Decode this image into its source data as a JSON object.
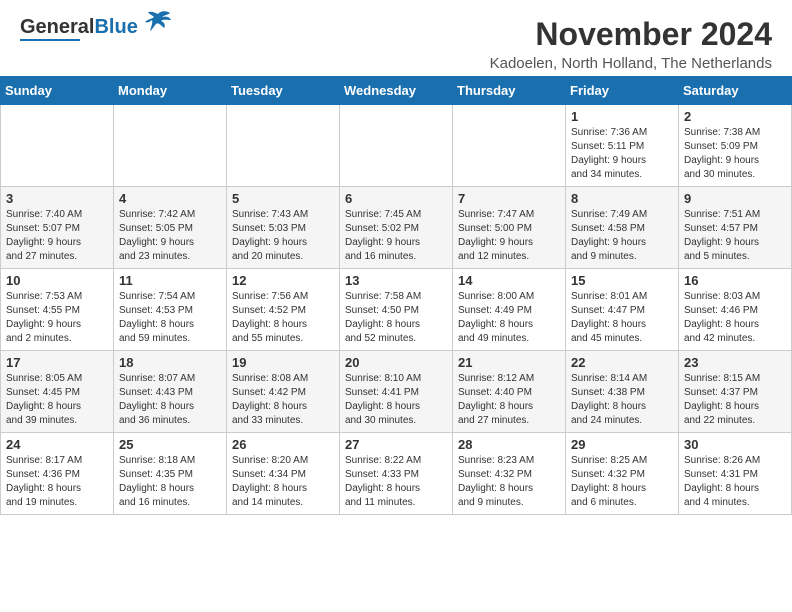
{
  "header": {
    "logo_general": "General",
    "logo_blue": "Blue",
    "month_title": "November 2024",
    "location": "Kadoelen, North Holland, The Netherlands"
  },
  "weekdays": [
    "Sunday",
    "Monday",
    "Tuesday",
    "Wednesday",
    "Thursday",
    "Friday",
    "Saturday"
  ],
  "weeks": [
    [
      {
        "day": "",
        "info": ""
      },
      {
        "day": "",
        "info": ""
      },
      {
        "day": "",
        "info": ""
      },
      {
        "day": "",
        "info": ""
      },
      {
        "day": "",
        "info": ""
      },
      {
        "day": "1",
        "info": "Sunrise: 7:36 AM\nSunset: 5:11 PM\nDaylight: 9 hours\nand 34 minutes."
      },
      {
        "day": "2",
        "info": "Sunrise: 7:38 AM\nSunset: 5:09 PM\nDaylight: 9 hours\nand 30 minutes."
      }
    ],
    [
      {
        "day": "3",
        "info": "Sunrise: 7:40 AM\nSunset: 5:07 PM\nDaylight: 9 hours\nand 27 minutes."
      },
      {
        "day": "4",
        "info": "Sunrise: 7:42 AM\nSunset: 5:05 PM\nDaylight: 9 hours\nand 23 minutes."
      },
      {
        "day": "5",
        "info": "Sunrise: 7:43 AM\nSunset: 5:03 PM\nDaylight: 9 hours\nand 20 minutes."
      },
      {
        "day": "6",
        "info": "Sunrise: 7:45 AM\nSunset: 5:02 PM\nDaylight: 9 hours\nand 16 minutes."
      },
      {
        "day": "7",
        "info": "Sunrise: 7:47 AM\nSunset: 5:00 PM\nDaylight: 9 hours\nand 12 minutes."
      },
      {
        "day": "8",
        "info": "Sunrise: 7:49 AM\nSunset: 4:58 PM\nDaylight: 9 hours\nand 9 minutes."
      },
      {
        "day": "9",
        "info": "Sunrise: 7:51 AM\nSunset: 4:57 PM\nDaylight: 9 hours\nand 5 minutes."
      }
    ],
    [
      {
        "day": "10",
        "info": "Sunrise: 7:53 AM\nSunset: 4:55 PM\nDaylight: 9 hours\nand 2 minutes."
      },
      {
        "day": "11",
        "info": "Sunrise: 7:54 AM\nSunset: 4:53 PM\nDaylight: 8 hours\nand 59 minutes."
      },
      {
        "day": "12",
        "info": "Sunrise: 7:56 AM\nSunset: 4:52 PM\nDaylight: 8 hours\nand 55 minutes."
      },
      {
        "day": "13",
        "info": "Sunrise: 7:58 AM\nSunset: 4:50 PM\nDaylight: 8 hours\nand 52 minutes."
      },
      {
        "day": "14",
        "info": "Sunrise: 8:00 AM\nSunset: 4:49 PM\nDaylight: 8 hours\nand 49 minutes."
      },
      {
        "day": "15",
        "info": "Sunrise: 8:01 AM\nSunset: 4:47 PM\nDaylight: 8 hours\nand 45 minutes."
      },
      {
        "day": "16",
        "info": "Sunrise: 8:03 AM\nSunset: 4:46 PM\nDaylight: 8 hours\nand 42 minutes."
      }
    ],
    [
      {
        "day": "17",
        "info": "Sunrise: 8:05 AM\nSunset: 4:45 PM\nDaylight: 8 hours\nand 39 minutes."
      },
      {
        "day": "18",
        "info": "Sunrise: 8:07 AM\nSunset: 4:43 PM\nDaylight: 8 hours\nand 36 minutes."
      },
      {
        "day": "19",
        "info": "Sunrise: 8:08 AM\nSunset: 4:42 PM\nDaylight: 8 hours\nand 33 minutes."
      },
      {
        "day": "20",
        "info": "Sunrise: 8:10 AM\nSunset: 4:41 PM\nDaylight: 8 hours\nand 30 minutes."
      },
      {
        "day": "21",
        "info": "Sunrise: 8:12 AM\nSunset: 4:40 PM\nDaylight: 8 hours\nand 27 minutes."
      },
      {
        "day": "22",
        "info": "Sunrise: 8:14 AM\nSunset: 4:38 PM\nDaylight: 8 hours\nand 24 minutes."
      },
      {
        "day": "23",
        "info": "Sunrise: 8:15 AM\nSunset: 4:37 PM\nDaylight: 8 hours\nand 22 minutes."
      }
    ],
    [
      {
        "day": "24",
        "info": "Sunrise: 8:17 AM\nSunset: 4:36 PM\nDaylight: 8 hours\nand 19 minutes."
      },
      {
        "day": "25",
        "info": "Sunrise: 8:18 AM\nSunset: 4:35 PM\nDaylight: 8 hours\nand 16 minutes."
      },
      {
        "day": "26",
        "info": "Sunrise: 8:20 AM\nSunset: 4:34 PM\nDaylight: 8 hours\nand 14 minutes."
      },
      {
        "day": "27",
        "info": "Sunrise: 8:22 AM\nSunset: 4:33 PM\nDaylight: 8 hours\nand 11 minutes."
      },
      {
        "day": "28",
        "info": "Sunrise: 8:23 AM\nSunset: 4:32 PM\nDaylight: 8 hours\nand 9 minutes."
      },
      {
        "day": "29",
        "info": "Sunrise: 8:25 AM\nSunset: 4:32 PM\nDaylight: 8 hours\nand 6 minutes."
      },
      {
        "day": "30",
        "info": "Sunrise: 8:26 AM\nSunset: 4:31 PM\nDaylight: 8 hours\nand 4 minutes."
      }
    ]
  ]
}
